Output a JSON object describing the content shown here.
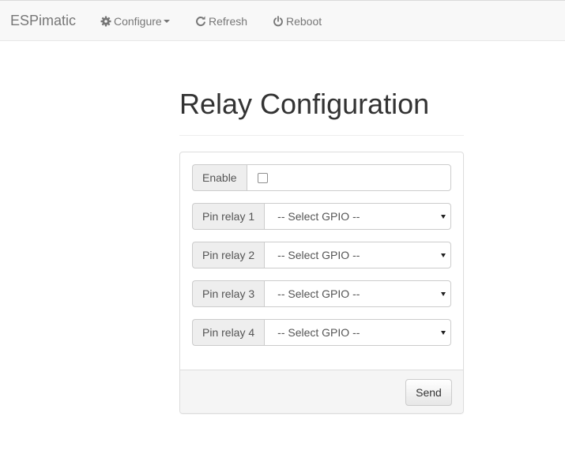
{
  "navbar": {
    "brand": "ESPimatic",
    "items": [
      {
        "label": "Configure",
        "icon": "gear-icon",
        "dropdown": true
      },
      {
        "label": "Refresh",
        "icon": "refresh-icon"
      },
      {
        "label": "Reboot",
        "icon": "power-icon"
      }
    ]
  },
  "page": {
    "title": "Relay Configuration"
  },
  "form": {
    "enable": {
      "label": "Enable",
      "checked": false
    },
    "relays": [
      {
        "label": "Pin relay 1",
        "value": "-- Select GPIO --"
      },
      {
        "label": "Pin relay 2",
        "value": "-- Select GPIO --"
      },
      {
        "label": "Pin relay 3",
        "value": "-- Select GPIO --"
      },
      {
        "label": "Pin relay 4",
        "value": "-- Select GPIO --"
      }
    ],
    "submit_label": "Send"
  }
}
